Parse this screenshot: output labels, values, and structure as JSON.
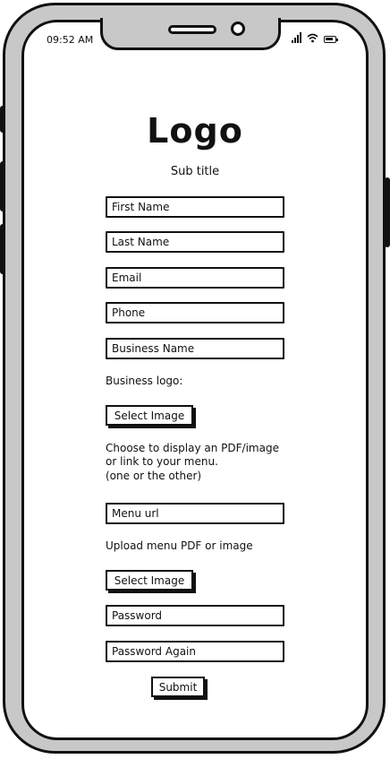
{
  "status_bar": {
    "time": "09:52 AM"
  },
  "header": {
    "logo": "Logo",
    "subtitle": "Sub title"
  },
  "form": {
    "first_name_placeholder": "First Name",
    "last_name_placeholder": "Last Name",
    "email_placeholder": "Email",
    "phone_placeholder": "Phone",
    "business_name_placeholder": "Business Name",
    "business_logo_label": "Business logo:",
    "select_image_label": "Select Image",
    "menu_instructions_line1": "Choose to display an PDF/image",
    "menu_instructions_line2": "or link to your menu.",
    "menu_instructions_line3": "(one or the other)",
    "menu_url_placeholder": "Menu url",
    "upload_menu_label": "Upload menu PDF or image",
    "select_menu_image_label": "Select Image",
    "password_placeholder": "Password",
    "password_again_placeholder": "Password Again",
    "submit_label": "Submit"
  }
}
